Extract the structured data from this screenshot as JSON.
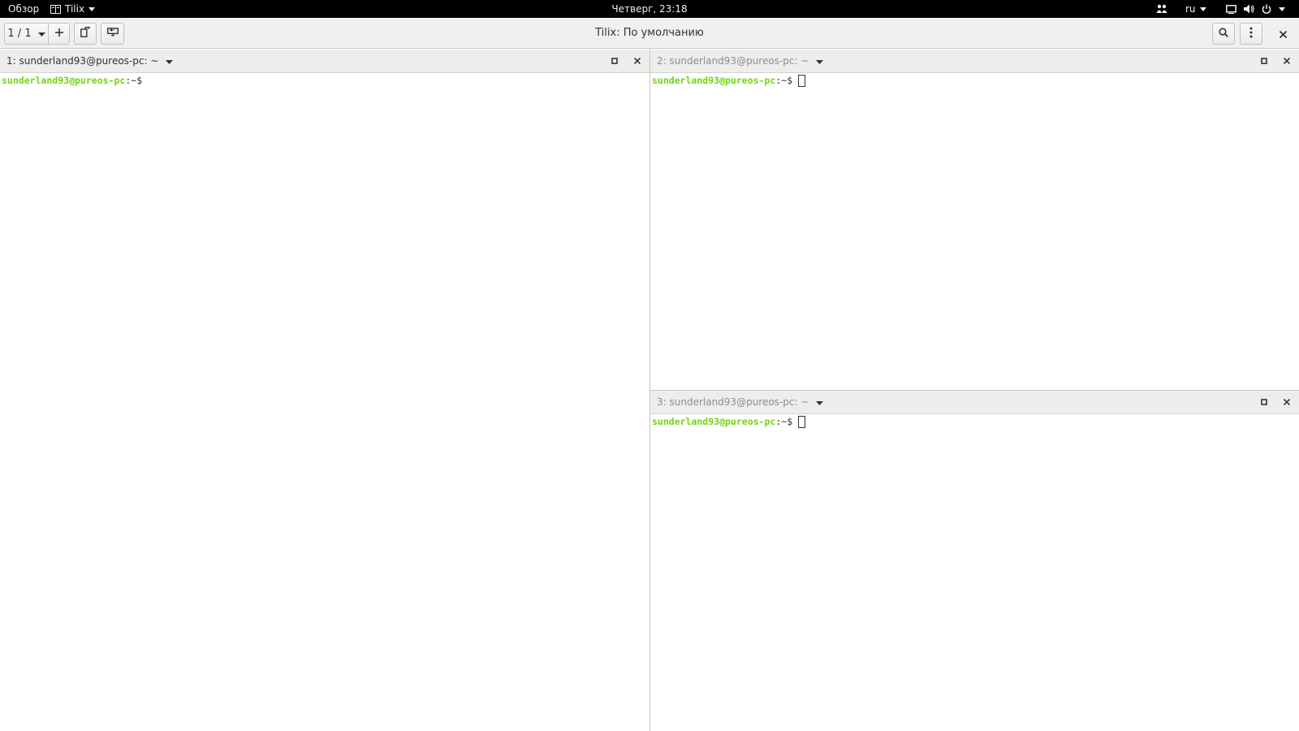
{
  "topbar": {
    "activities": "Обзор",
    "app_name": "Tilix",
    "clock": "Четверг, 23:18",
    "keyboard_layout": "ru"
  },
  "headerbar": {
    "session_counter": "1 / 1",
    "title": "Tilix: По умолчанию",
    "icons": [
      "add-session-icon",
      "new-terminal-window-icon",
      "sessions-sidebar-icon",
      "search-icon",
      "menu-icon",
      "close-icon"
    ]
  },
  "panes": [
    {
      "title": "1: sunderland93@pureos-pc: ~",
      "active": true,
      "prompt_user": "sunderland93@pureos-pc",
      "prompt_sep": ":",
      "prompt_path": "~$"
    },
    {
      "title": "2: sunderland93@pureos-pc: ~",
      "active": false,
      "prompt_user": "sunderland93@pureos-pc",
      "prompt_sep": ":",
      "prompt_path": "~$"
    },
    {
      "title": "3: sunderland93@pureos-pc: ~",
      "active": false,
      "prompt_user": "sunderland93@pureos-pc",
      "prompt_sep": ":",
      "prompt_path": "~$"
    }
  ],
  "colors": {
    "prompt_user": "#73d216",
    "topbar_bg": "#000000",
    "headerbar_bg": "#f0f0ef"
  }
}
